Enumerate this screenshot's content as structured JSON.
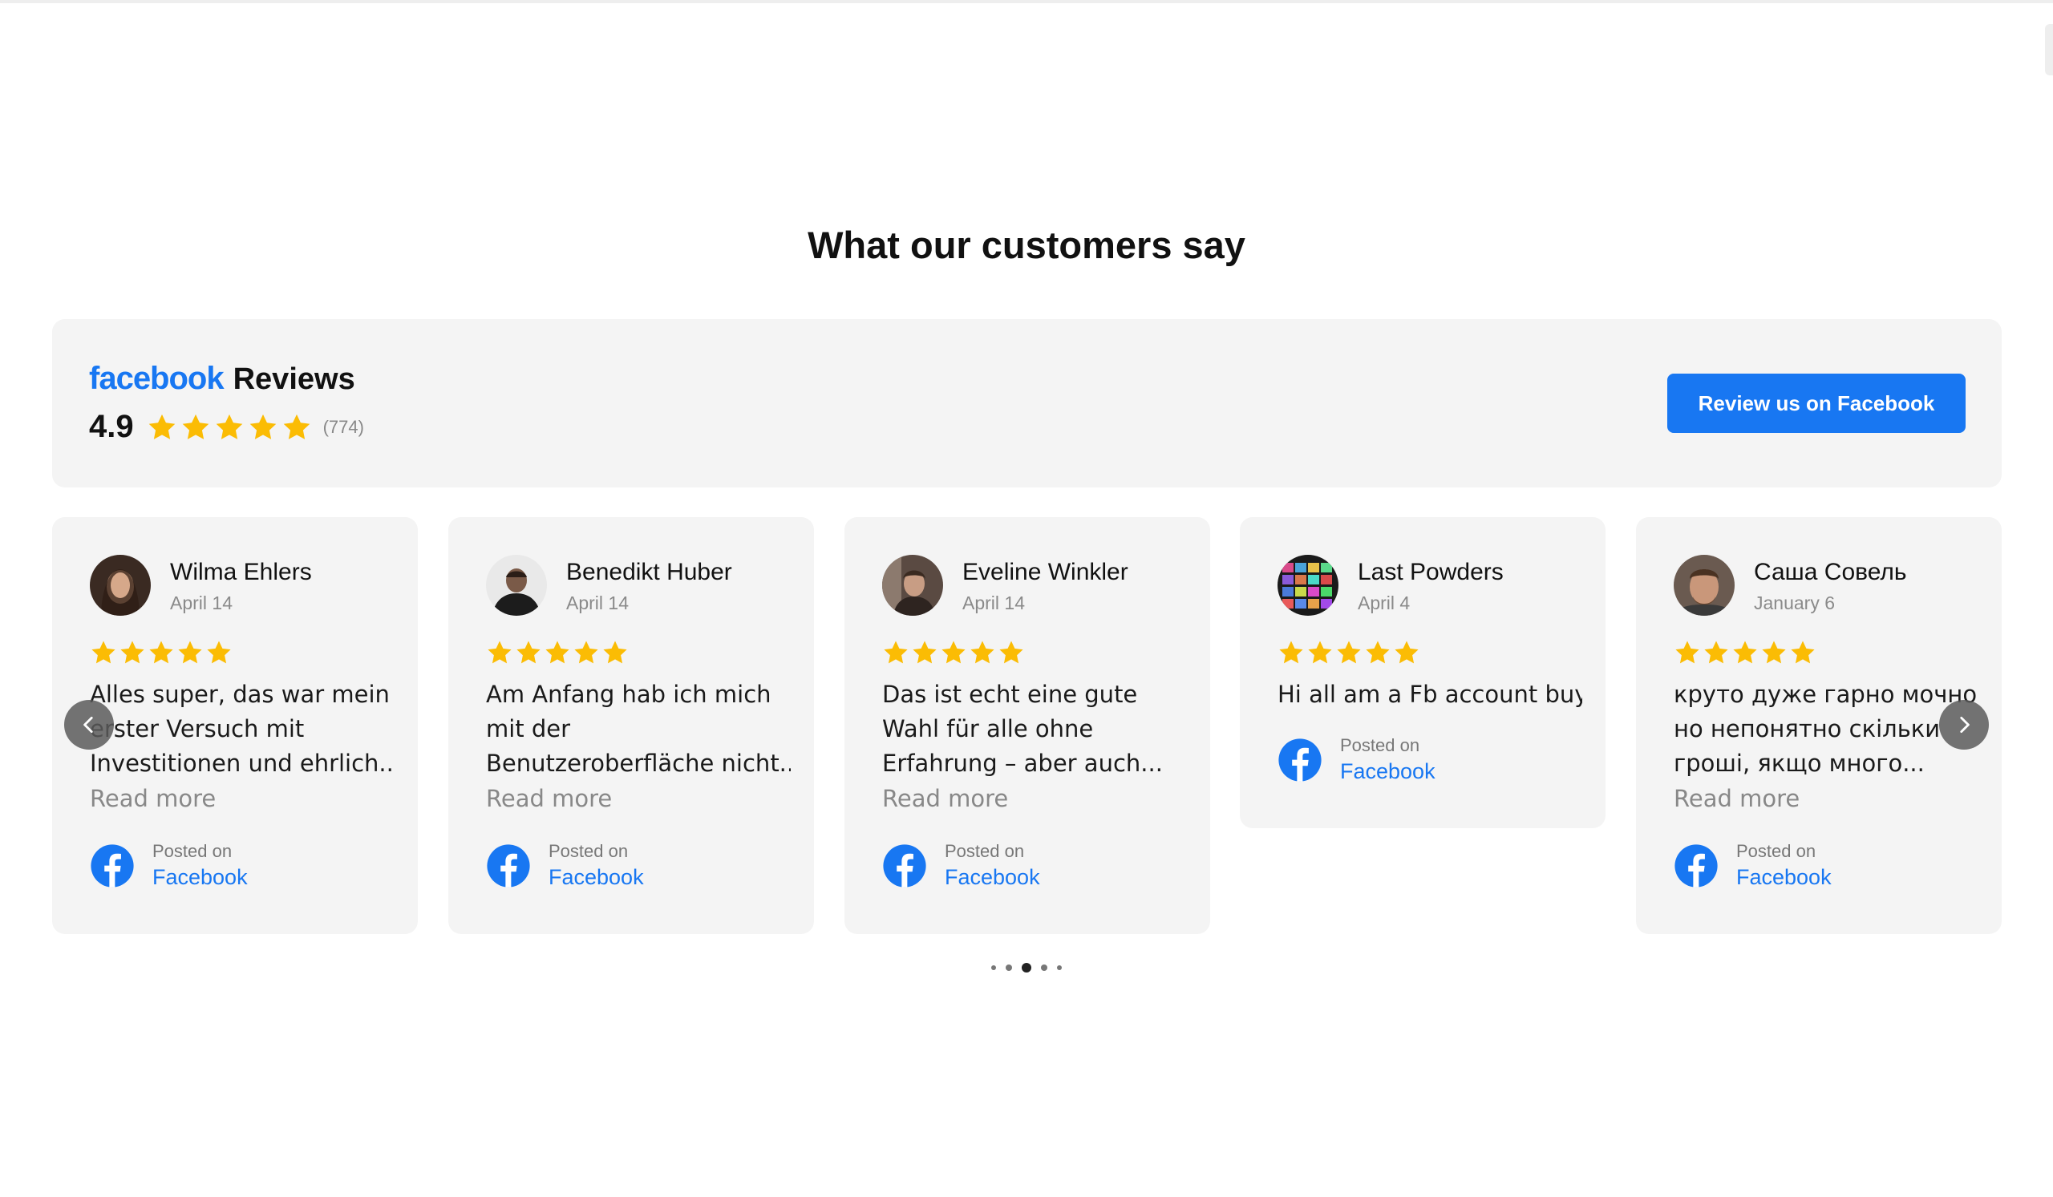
{
  "section": {
    "title": "What our customers say"
  },
  "summary": {
    "brand": "facebook",
    "reviews_label": "Reviews",
    "rating": "4.9",
    "stars": 5,
    "count": "(774)",
    "button_label": "Review us on Facebook"
  },
  "colors": {
    "brand_blue": "#1877f2",
    "star": "#fbbc04",
    "panel": "#f4f4f4"
  },
  "reviews": [
    {
      "name": "Wilma Ehlers",
      "date": "April 14",
      "stars": 5,
      "lines": [
        "Alles super, das war mein",
        "erster Versuch mit",
        "Investitionen und ehrlich..."
      ],
      "read_more": "Read more",
      "posted_on": "Posted on",
      "platform": "Facebook"
    },
    {
      "name": "Benedikt Huber",
      "date": "April 14",
      "stars": 5,
      "lines": [
        "Am Anfang hab ich mich",
        "mit der",
        "Benutzeroberfläche nicht..."
      ],
      "read_more": "Read more",
      "posted_on": "Posted on",
      "platform": "Facebook"
    },
    {
      "name": "Eveline Winkler",
      "date": "April 14",
      "stars": 5,
      "lines": [
        "Das ist echt eine gute",
        "Wahl für alle ohne",
        "Erfahrung – aber auch..."
      ],
      "read_more": "Read more",
      "posted_on": "Posted on",
      "platform": "Facebook"
    },
    {
      "name": "Last Powders",
      "date": "April 4",
      "stars": 5,
      "lines": [
        "Hi all am a Fb account buy"
      ],
      "posted_on": "Posted on",
      "platform": "Facebook"
    },
    {
      "name": "Саша Совель",
      "date": "January 6",
      "stars": 5,
      "lines": [
        "круто дуже гарно мочно",
        "но непонятно скільки",
        "гроші, якщо много..."
      ],
      "read_more": "Read more",
      "posted_on": "Posted on",
      "platform": "Facebook"
    }
  ],
  "carousel": {
    "dots": 5,
    "active_dot": 3
  }
}
